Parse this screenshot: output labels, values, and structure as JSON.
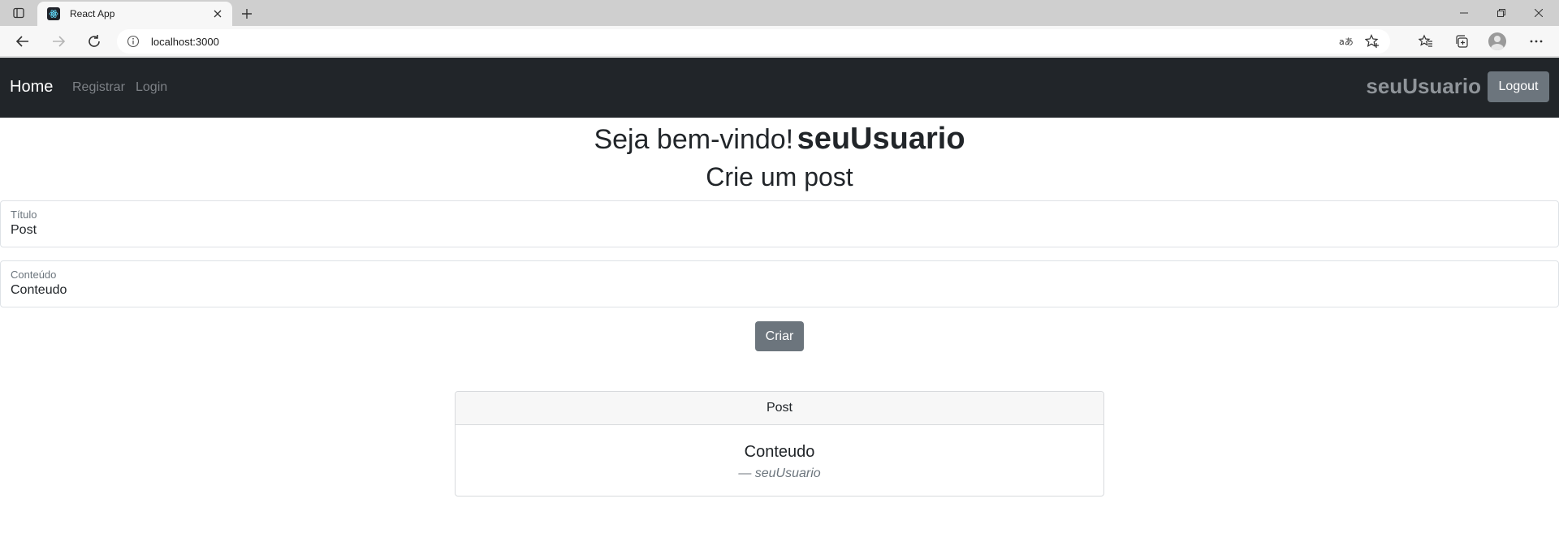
{
  "browser": {
    "tab_title": "React App",
    "url": "localhost:3000"
  },
  "navbar": {
    "brand": "Home",
    "links": [
      "Registrar",
      "Login"
    ],
    "username": "seuUsuario",
    "logout_label": "Logout"
  },
  "main": {
    "welcome_text": "Seja bem-vindo!",
    "welcome_user": "seuUsuario",
    "form_title": "Crie um post",
    "fields": [
      {
        "label": "Título",
        "value": "Post"
      },
      {
        "label": "Conteúdo",
        "value": "Conteudo"
      }
    ],
    "create_label": "Criar"
  },
  "posts": [
    {
      "title": "Post",
      "content": "Conteudo",
      "author": "— seuUsuario"
    }
  ],
  "colors": {
    "navbar_bg": "#212529",
    "button_secondary": "#6c757d"
  }
}
